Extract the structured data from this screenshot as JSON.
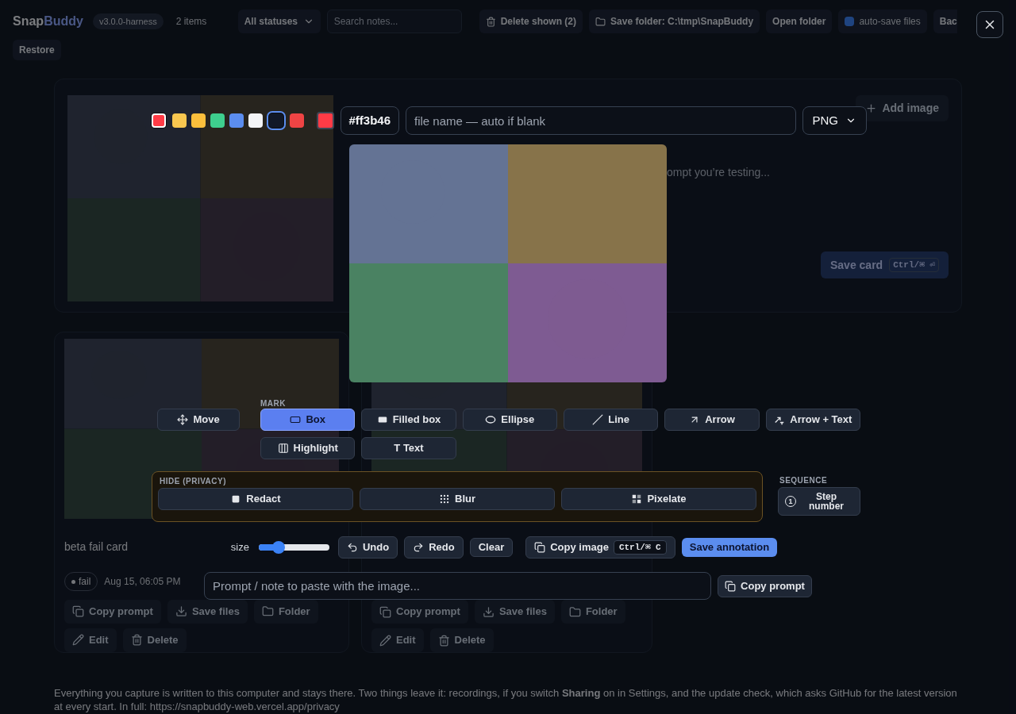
{
  "header": {
    "brand_prefix": "Snap",
    "brand_suffix": "Buddy",
    "version": "v3.0.0-harness",
    "count": "2 items",
    "status_filter": {
      "value": "All statuses"
    },
    "search": {
      "placeholder": "Search notes..."
    },
    "delete_button": "Delete shown (2)",
    "save_folder_button": "Save folder: C:\\tmp\\SnapBuddy",
    "open_folder_button": "Open folder",
    "auto_save": {
      "label": "auto-save files",
      "checked": true
    },
    "backup_button": "Bac",
    "restore_button": "Restore"
  },
  "composer": {
    "add_image_button": "Add image",
    "prompt_placeholder": "ompt you’re testing...",
    "save_button": {
      "label": "Save card",
      "shortcut": "Ctrl/⌘ ⏎"
    }
  },
  "cards": [
    {
      "title": "beta fail card",
      "status": {
        "label": "fail"
      },
      "date": "Aug 15, 06:05 PM",
      "actions": [
        {
          "kind": "copy",
          "label": "Copy prompt"
        },
        {
          "kind": "save",
          "label": "Save files"
        },
        {
          "kind": "folder",
          "label": "Folder"
        }
      ],
      "secondary_actions": [
        {
          "kind": "edit",
          "label": "Edit"
        },
        {
          "kind": "delete",
          "label": "Delete"
        }
      ]
    },
    {
      "actions": [
        {
          "kind": "copy",
          "label": "Copy prompt"
        },
        {
          "kind": "save",
          "label": "Save files"
        },
        {
          "kind": "folder",
          "label": "Folder"
        }
      ],
      "secondary_actions": [
        {
          "kind": "edit",
          "label": "Edit"
        },
        {
          "kind": "delete",
          "label": "Delete"
        }
      ]
    }
  ],
  "footer": {
    "text": "Everything you capture is written to this computer and stays there. Two things leave it: recordings, if you switch **Sharing** on in Settings, and the update check, which asks GitHub for the latest version at every start. In full:",
    "link": "https://snapbuddy-web.vercel.app/privacy"
  },
  "annotator": {
    "swatches": [
      {
        "color": "#ff3b46",
        "selected": true,
        "focused": false
      },
      {
        "color": "#f9c74f",
        "selected": false,
        "focused": false
      },
      {
        "color": "#fbbf3c",
        "selected": false,
        "focused": false
      },
      {
        "color": "#3ecf8e",
        "selected": false,
        "focused": false
      },
      {
        "color": "#5b8def",
        "selected": false,
        "focused": false
      },
      {
        "color": "#f3f4f6",
        "selected": false,
        "focused": false
      },
      {
        "color": "#111827",
        "selected": false,
        "focused": true
      },
      {
        "color": "#ef4444",
        "selected": false,
        "focused": false
      }
    ],
    "current_swatch": {
      "color": "#ff3b46"
    },
    "hex_value": "#ff3b46",
    "filename": {
      "placeholder": "file name — auto if blank"
    },
    "format": {
      "value": "PNG"
    },
    "move_tool": {
      "kind": "move",
      "label": "Move",
      "selected": false
    },
    "mark": {
      "heading": "MARK",
      "tools": [
        {
          "kind": "box",
          "label": "Box",
          "selected": true
        },
        {
          "kind": "filled_box",
          "label": "Filled box",
          "selected": false
        },
        {
          "kind": "ellipse",
          "label": "Ellipse",
          "selected": false
        },
        {
          "kind": "line",
          "label": "Line",
          "selected": false
        },
        {
          "kind": "arrow",
          "label": "Arrow",
          "selected": false
        },
        {
          "kind": "arrow_text",
          "label": "Arrow + Text",
          "selected": false
        },
        {
          "kind": "highlight",
          "label": "Highlight",
          "selected": false
        },
        {
          "kind": "text",
          "label": "T Text",
          "selected": false
        }
      ]
    },
    "hide": {
      "heading": "HIDE (PRIVACY)",
      "tools": [
        {
          "kind": "redact",
          "label": "Redact",
          "selected": false
        },
        {
          "kind": "blur",
          "label": "Blur",
          "selected": false
        },
        {
          "kind": "pixelate",
          "label": "Pixelate",
          "selected": false
        }
      ]
    },
    "sequence": {
      "heading": "SEQUENCE",
      "tool": {
        "badge": "1",
        "label": "Step number",
        "selected": false
      }
    },
    "size": {
      "label": "size",
      "level": 0.28
    },
    "undo_button": "Undo",
    "redo_button": "Redo",
    "clear_button": "Clear",
    "copy_image": {
      "label": "Copy image",
      "shortcut": "Ctrl/⌘ C"
    },
    "save_button": "Save annotation",
    "prompt": {
      "placeholder": "Prompt / note to paste with the image..."
    },
    "copy_prompt_button": "Copy prompt"
  }
}
